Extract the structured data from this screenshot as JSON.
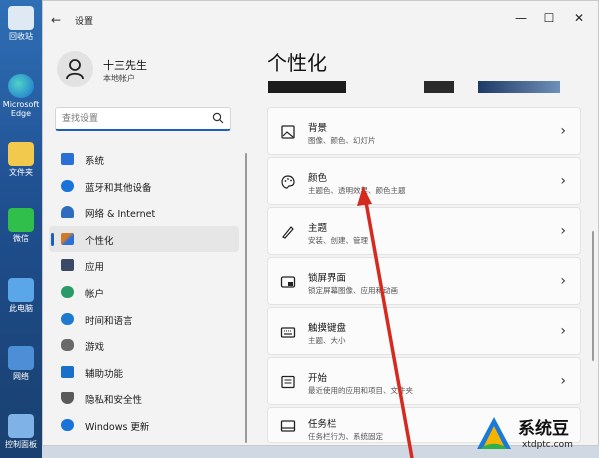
{
  "desktop": {
    "icons": [
      {
        "label": "回收站",
        "icon": "recycle-bin-icon"
      },
      {
        "label": "Microsoft Edge",
        "icon": "edge-icon"
      },
      {
        "label": "文件夹",
        "icon": "folder-icon"
      },
      {
        "label": "微信",
        "icon": "wechat-icon"
      },
      {
        "label": "此电脑",
        "icon": "computer-icon"
      },
      {
        "label": "网络",
        "icon": "network-icon"
      },
      {
        "label": "控制面板",
        "icon": "control-panel-icon"
      }
    ]
  },
  "window": {
    "title": "设置",
    "back": "←",
    "controls": {
      "minimize": "—",
      "maximize": "☐",
      "close": "✕"
    }
  },
  "profile": {
    "name": "十三先生",
    "account": "本地帐户"
  },
  "search": {
    "placeholder": "查找设置",
    "icon": "search-icon"
  },
  "nav": {
    "items": [
      {
        "label": "系统",
        "icon": "monitor-icon",
        "color": "#2a6fd6"
      },
      {
        "label": "蓝牙和其他设备",
        "icon": "bluetooth-icon",
        "color": "#1a73d9"
      },
      {
        "label": "网络 & Internet",
        "icon": "wifi-icon",
        "color": "#2f6cbf"
      },
      {
        "label": "个性化",
        "icon": "brush-icon",
        "color": "#d07a2c",
        "selected": true
      },
      {
        "label": "应用",
        "icon": "apps-icon",
        "color": "#3a4a66"
      },
      {
        "label": "帐户",
        "icon": "account-icon",
        "color": "#2a9a6a"
      },
      {
        "label": "时间和语言",
        "icon": "globe-clock-icon",
        "color": "#1d7ad0"
      },
      {
        "label": "游戏",
        "icon": "gamepad-icon",
        "color": "#6a6a6a"
      },
      {
        "label": "辅助功能",
        "icon": "accessibility-icon",
        "color": "#1a6fc9"
      },
      {
        "label": "隐私和安全性",
        "icon": "shield-icon",
        "color": "#5a5a5a"
      },
      {
        "label": "Windows 更新",
        "icon": "update-icon",
        "color": "#1a73d9"
      }
    ]
  },
  "main": {
    "title": "个性化",
    "cards": [
      {
        "title": "背景",
        "subtitle": "图像、颜色、幻灯片",
        "icon": "image-icon"
      },
      {
        "title": "颜色",
        "subtitle": "主题色、透明效果、颜色主题",
        "icon": "palette-icon"
      },
      {
        "title": "主题",
        "subtitle": "安装、创建、管理",
        "icon": "brush-pen-icon"
      },
      {
        "title": "锁屏界面",
        "subtitle": "锁定屏幕图像、应用和动画",
        "icon": "lock-screen-icon"
      },
      {
        "title": "触摸键盘",
        "subtitle": "主题、大小",
        "icon": "keyboard-icon"
      },
      {
        "title": "开始",
        "subtitle": "最近使用的应用和项目、文件夹",
        "icon": "start-icon"
      },
      {
        "title": "任务栏",
        "subtitle": "任务栏行为、系统固定",
        "icon": "taskbar-icon"
      }
    ],
    "chevron": "›"
  },
  "annotation": {
    "color": "#d42a1f"
  },
  "watermark": {
    "name": "系统豆",
    "url": "xtdptc.com",
    "icon": "xtdptc-logo-icon"
  }
}
